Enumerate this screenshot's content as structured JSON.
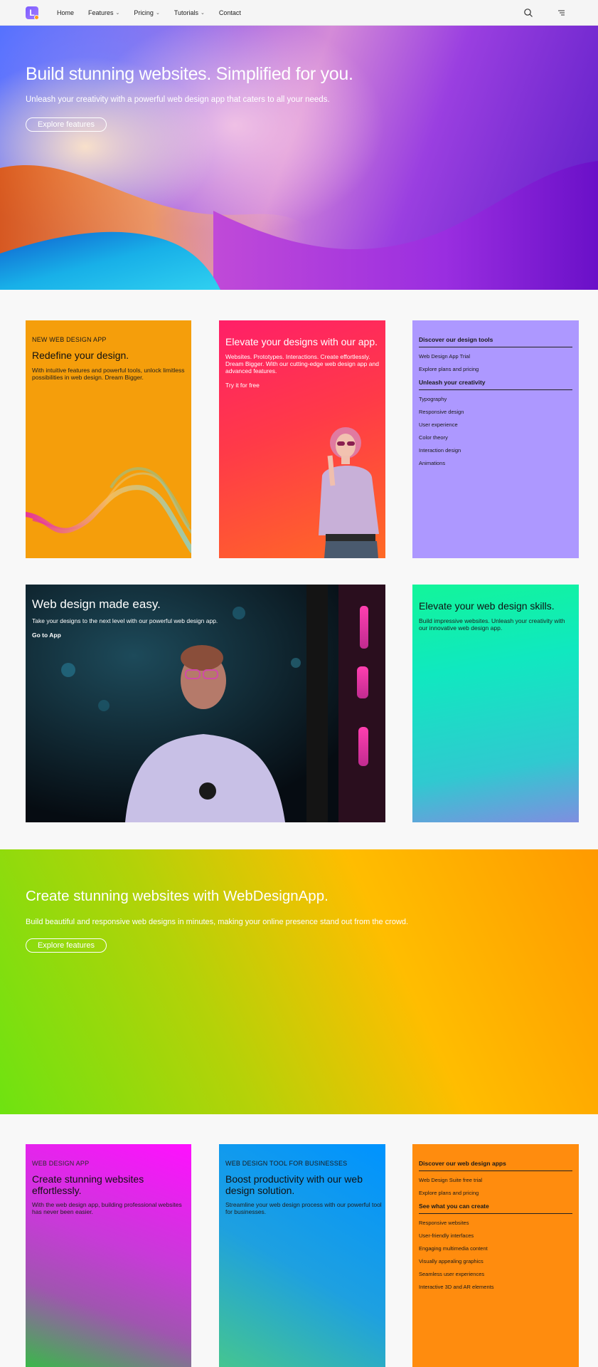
{
  "nav": {
    "logo_letter": "L",
    "links": [
      "Home",
      "Features",
      "Pricing",
      "Tutorials",
      "Contact"
    ]
  },
  "hero": {
    "title": "Build stunning websites. Simplified for you.",
    "subtitle": "Unleash your creativity with a powerful web design app that caters to all your needs.",
    "button": "Explore features"
  },
  "card1": {
    "eyebrow": "NEW WEB DESIGN APP",
    "title": "Redefine your design.",
    "body": "With intuitive features and powerful tools, unlock limitless possibilities in web design. Dream Bigger."
  },
  "card2": {
    "title": "Elevate your designs with our app.",
    "body": "Websites. Prototypes. Interactions. Create effortlessly. Dream Bigger. With our cutting-edge web design app and advanced features.",
    "link": "Try it for free"
  },
  "card3": {
    "group1_title": "Discover our design tools",
    "group1_items": [
      "Web Design App Trial",
      "Explore plans and pricing"
    ],
    "group2_title": "Unleash your creativity",
    "group2_items": [
      "Typography",
      "Responsive design",
      "User experience",
      "Color theory",
      "Interaction design",
      "Animations"
    ]
  },
  "card4": {
    "title": "Web design made easy.",
    "body": "Take your designs to the next level with our powerful web design app.",
    "link": "Go to App"
  },
  "card5": {
    "title": "Elevate your web design skills.",
    "body": "Build impressive websites. Unleash your creativity with our innovative web design app."
  },
  "band": {
    "title": "Create stunning websites with WebDesignApp.",
    "subtitle": "Build beautiful and responsive web designs in minutes, making your online presence stand out from the crowd.",
    "button": "Explore features"
  },
  "card6": {
    "eyebrow": "WEB DESIGN APP",
    "title": "Create stunning websites effortlessly.",
    "body": "With the web design app, building professional websites has never been easier."
  },
  "card7": {
    "eyebrow": "WEB DESIGN TOOL FOR BUSINESSES",
    "title": "Boost productivity with our web design solution.",
    "body": "Streamline your web design process with our powerful tool for businesses."
  },
  "card8": {
    "group1_title": "Discover our web design apps",
    "group1_items": [
      "Web Design Suite free trial",
      "Explore plans and pricing"
    ],
    "group2_title": "See what you can create",
    "group2_items": [
      "Responsive websites",
      "User-friendly interfaces",
      "Engaging multimedia content",
      "Visually appealing graphics",
      "Seamless user experiences",
      "Interactive 3D and AR elements"
    ]
  },
  "icons": [
    "logo-icon",
    "chevron-down-icon",
    "search-icon",
    "menu-icon"
  ]
}
